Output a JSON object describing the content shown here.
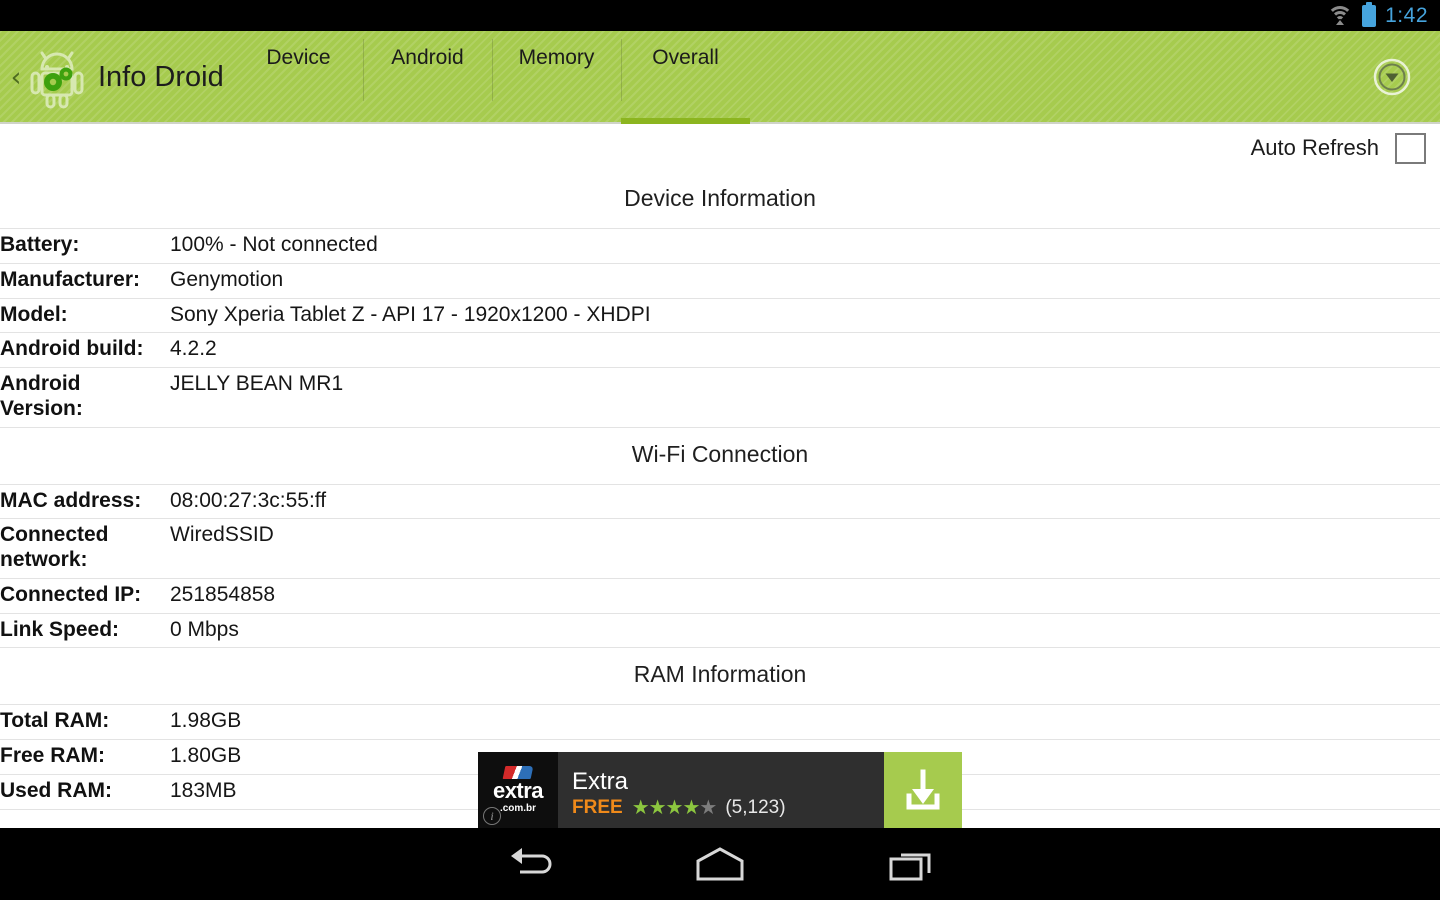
{
  "status_bar": {
    "wifi_icon": "wifi-icon",
    "battery_icon": "battery-icon",
    "clock": "1:42"
  },
  "action_bar": {
    "back_chevron": "‹",
    "app_icon": "android-gear-icon",
    "title": "Info Droid",
    "overflow_icon": "chevron-down-circle-icon",
    "tabs": [
      {
        "label": "Device",
        "selected": false
      },
      {
        "label": "Android",
        "selected": false
      },
      {
        "label": "Memory",
        "selected": false
      },
      {
        "label": "Overall",
        "selected": true
      }
    ],
    "accent_color": "#a6cb4e",
    "tab_indicator_color": "#8cb520"
  },
  "auto_refresh": {
    "label": "Auto Refresh",
    "checked": false
  },
  "sections": [
    {
      "title": "Device Information",
      "rows": [
        {
          "label": "Battery:",
          "value": "100% - Not connected"
        },
        {
          "label": "Manufacturer:",
          "value": "Genymotion"
        },
        {
          "label": "Model:",
          "value": "Sony Xperia Tablet Z - API 17 - 1920x1200 - XHDPI"
        },
        {
          "label": "Android build:",
          "value": "4.2.2"
        },
        {
          "label": "Android Version:",
          "value": "JELLY BEAN MR1"
        }
      ]
    },
    {
      "title": "Wi-Fi Connection",
      "rows": [
        {
          "label": "MAC address:",
          "value": "08:00:27:3c:55:ff"
        },
        {
          "label": "Connected network:",
          "value": "WiredSSID"
        },
        {
          "label": "Connected IP:",
          "value": "251854858"
        },
        {
          "label": "Link Speed:",
          "value": "0 Mbps"
        }
      ]
    },
    {
      "title": "RAM Information",
      "rows": [
        {
          "label": "Total RAM:",
          "value": "1.98GB"
        },
        {
          "label": "Free RAM:",
          "value": "1.80GB"
        },
        {
          "label": "Used RAM:",
          "value": "183MB"
        }
      ]
    }
  ],
  "ad": {
    "logo_text": "extra",
    "logo_domain": ".com.br",
    "info_glyph": "i",
    "title": "Extra",
    "price": "FREE",
    "stars_filled": 4,
    "stars_total": 5,
    "rating_count": "(5,123)",
    "download_icon": "download-icon",
    "button_color": "#a6cb4e"
  },
  "nav_bar": {
    "back_icon": "back-arrow-icon",
    "home_icon": "home-icon",
    "recents_icon": "recent-apps-icon"
  }
}
